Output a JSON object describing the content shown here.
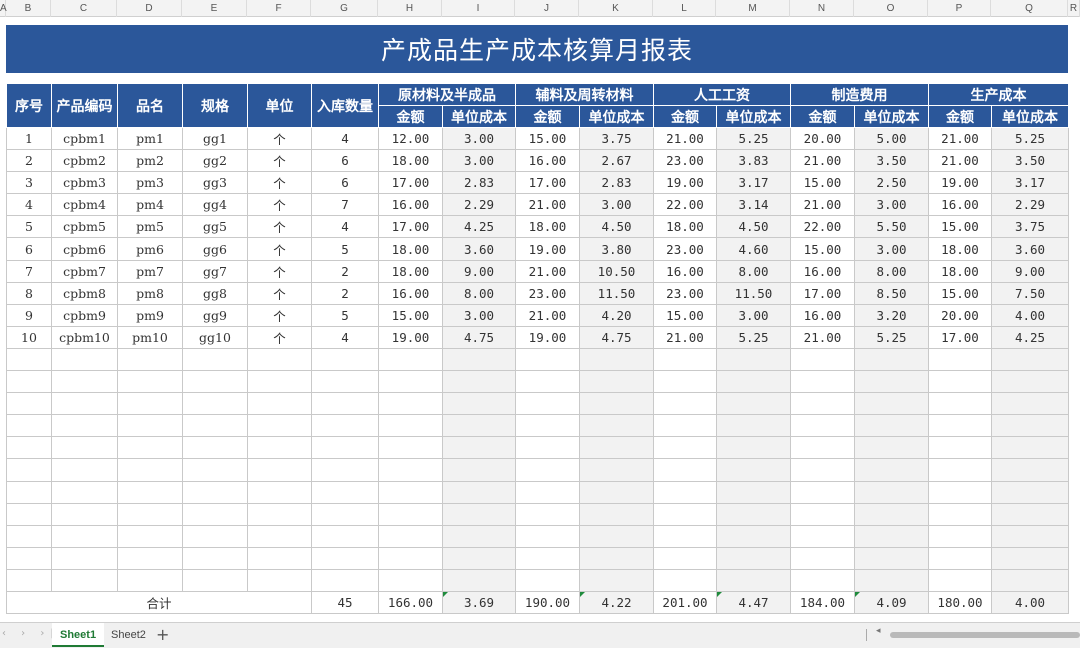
{
  "columns": [
    "A",
    "B",
    "C",
    "D",
    "E",
    "F",
    "G",
    "H",
    "I",
    "J",
    "K",
    "L",
    "M",
    "N",
    "O",
    "P",
    "Q",
    "R"
  ],
  "title": "产成品生产成本核算月报表",
  "headers": {
    "seq": "序号",
    "code": "产品编码",
    "name": "品名",
    "spec": "规格",
    "unit": "单位",
    "qty": "入库数量",
    "groups": [
      "原材料及半成品",
      "辅料及周转材料",
      "人工工资",
      "制造费用",
      "生产成本"
    ],
    "amount": "金额",
    "unit_cost": "单位成本"
  },
  "rows": [
    [
      "1",
      "cpbm1",
      "pm1",
      "gg1",
      "个",
      "4",
      "12.00",
      "3.00",
      "15.00",
      "3.75",
      "21.00",
      "5.25",
      "20.00",
      "5.00",
      "21.00",
      "5.25"
    ],
    [
      "2",
      "cpbm2",
      "pm2",
      "gg2",
      "个",
      "6",
      "18.00",
      "3.00",
      "16.00",
      "2.67",
      "23.00",
      "3.83",
      "21.00",
      "3.50",
      "21.00",
      "3.50"
    ],
    [
      "3",
      "cpbm3",
      "pm3",
      "gg3",
      "个",
      "6",
      "17.00",
      "2.83",
      "17.00",
      "2.83",
      "19.00",
      "3.17",
      "15.00",
      "2.50",
      "19.00",
      "3.17"
    ],
    [
      "4",
      "cpbm4",
      "pm4",
      "gg4",
      "个",
      "7",
      "16.00",
      "2.29",
      "21.00",
      "3.00",
      "22.00",
      "3.14",
      "21.00",
      "3.00",
      "16.00",
      "2.29"
    ],
    [
      "5",
      "cpbm5",
      "pm5",
      "gg5",
      "个",
      "4",
      "17.00",
      "4.25",
      "18.00",
      "4.50",
      "18.00",
      "4.50",
      "22.00",
      "5.50",
      "15.00",
      "3.75"
    ],
    [
      "6",
      "cpbm6",
      "pm6",
      "gg6",
      "个",
      "5",
      "18.00",
      "3.60",
      "19.00",
      "3.80",
      "23.00",
      "4.60",
      "15.00",
      "3.00",
      "18.00",
      "3.60"
    ],
    [
      "7",
      "cpbm7",
      "pm7",
      "gg7",
      "个",
      "2",
      "18.00",
      "9.00",
      "21.00",
      "10.50",
      "16.00",
      "8.00",
      "16.00",
      "8.00",
      "18.00",
      "9.00"
    ],
    [
      "8",
      "cpbm8",
      "pm8",
      "gg8",
      "个",
      "2",
      "16.00",
      "8.00",
      "23.00",
      "11.50",
      "23.00",
      "11.50",
      "17.00",
      "8.50",
      "15.00",
      "7.50"
    ],
    [
      "9",
      "cpbm9",
      "pm9",
      "gg9",
      "个",
      "5",
      "15.00",
      "3.00",
      "21.00",
      "4.20",
      "15.00",
      "3.00",
      "16.00",
      "3.20",
      "20.00",
      "4.00"
    ],
    [
      "10",
      "cpbm10",
      "pm10",
      "gg10",
      "个",
      "4",
      "19.00",
      "4.75",
      "19.00",
      "4.75",
      "21.00",
      "5.25",
      "21.00",
      "5.25",
      "17.00",
      "4.25"
    ]
  ],
  "empty_rows": 11,
  "total": {
    "label": "合计",
    "qty": "45",
    "values": [
      "166.00",
      "3.69",
      "190.00",
      "4.22",
      "201.00",
      "4.47",
      "184.00",
      "4.09",
      "180.00",
      "4.00"
    ]
  },
  "sheets": [
    "Sheet1",
    "Sheet2"
  ],
  "nav_arrows": "‹ › ›|",
  "add_sheet": "+",
  "scroll_arrow": "◂",
  "colors": {
    "header_blue": "#2b579a",
    "shade": "#f2f2f2",
    "active_tab": "#1f7a34"
  }
}
